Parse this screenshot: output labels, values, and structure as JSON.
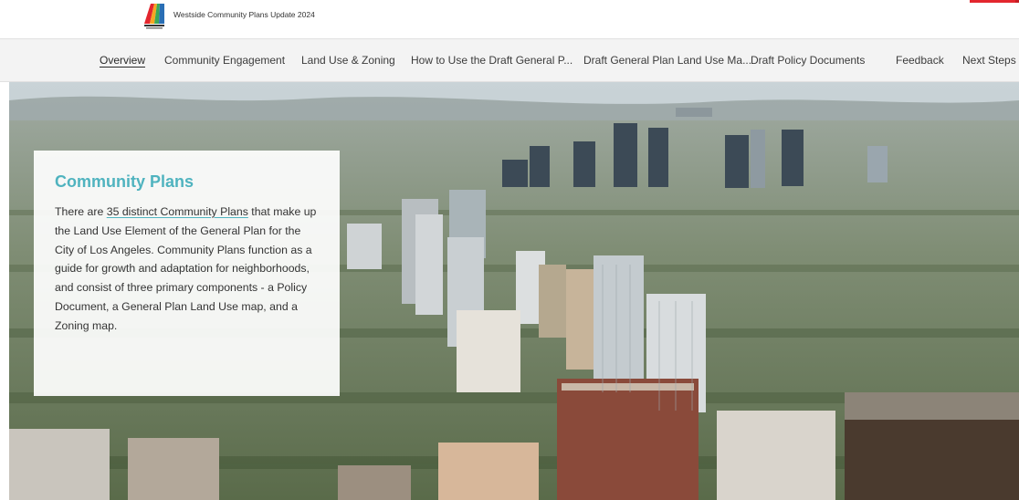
{
  "header": {
    "site_title": "Westside Community Plans Update 2024",
    "logo_icon": "los-angeles-city-logo"
  },
  "nav": {
    "items": [
      {
        "label": "Overview",
        "active": true
      },
      {
        "label": "Community Engagement"
      },
      {
        "label": "Land Use & Zoning"
      },
      {
        "label": "How to Use the Draft General P..."
      },
      {
        "label": "Draft General Plan Land Use Ma..."
      },
      {
        "label": "Draft Policy Documents"
      },
      {
        "label": "Feedback"
      },
      {
        "label": "Next Steps"
      }
    ]
  },
  "hero": {
    "image": "aerial-cityscape-photo",
    "card": {
      "title": "Community Plans",
      "body_pre": "There are ",
      "body_link": "35 distinct Community Plans",
      "body_post": " that make up the Land Use Element of the General Plan for the City of Los Angeles. Community Plans function as a guide for growth and adaptation for neighborhoods, and consist of three primary components - a Policy Document, a General Plan Land Use map, and a Zoning map."
    }
  },
  "colors": {
    "accent": "#4fb3bf",
    "nav_bg": "#f3f3f3",
    "brand_red": "#e3262e"
  }
}
